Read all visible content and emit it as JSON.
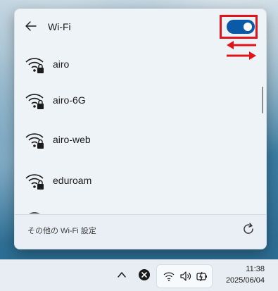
{
  "panel": {
    "title": "Wi-Fi",
    "toggle_state": "on",
    "accent_color": "#0b5aa8",
    "annotation_color": "#e3131a"
  },
  "networks": [
    {
      "name": "airo",
      "icon": "secured-wifi-icon"
    },
    {
      "name": "airo-6G",
      "icon": "secured-wifi-icon"
    },
    {
      "name": "airo-web",
      "icon": "secured-wifi-icon"
    },
    {
      "name": "eduroam",
      "icon": "secured-wifi-icon"
    }
  ],
  "footer": {
    "more_settings_label": "その他の Wi-Fi 設定",
    "refresh_icon": "refresh-icon"
  },
  "taskbar": {
    "time": "11:38",
    "date": "2025/06/04",
    "icons": [
      "chevron-up-icon",
      "close-circle-icon",
      "wifi-icon",
      "volume-icon",
      "battery-icon"
    ]
  }
}
